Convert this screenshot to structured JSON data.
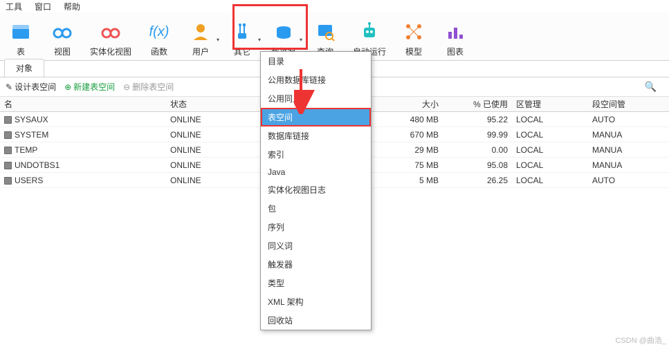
{
  "menubar": {
    "items": [
      "工具",
      "窗口",
      "帮助"
    ]
  },
  "ribbon": [
    {
      "label": "表",
      "icon": "table"
    },
    {
      "label": "视图",
      "icon": "glasses"
    },
    {
      "label": "实体化视图",
      "icon": "glasses-red"
    },
    {
      "label": "函数",
      "icon": "fx"
    },
    {
      "label": "用户",
      "icon": "user",
      "split": true
    },
    {
      "label": "其它",
      "icon": "tools",
      "split": true,
      "highlight": true
    },
    {
      "label": "数据泵",
      "icon": "pump",
      "split": true
    },
    {
      "label": "查询",
      "icon": "query"
    },
    {
      "label": "自动运行",
      "icon": "robot"
    },
    {
      "label": "模型",
      "icon": "model"
    },
    {
      "label": "图表",
      "icon": "chart"
    }
  ],
  "tabs": {
    "active": "对象"
  },
  "toolbar": {
    "design": "设计表空间",
    "new": "新建表空间",
    "delete": "删除表空间"
  },
  "columns": {
    "name": "名",
    "status": "状态",
    "size": "大小",
    "pct": "% 已使用",
    "ext": "区管理",
    "seg": "段空间管"
  },
  "rows": [
    {
      "name": "SYSAUX",
      "status": "ONLINE",
      "size": "480 MB",
      "pct": "95.22",
      "ext": "LOCAL",
      "seg": "AUTO"
    },
    {
      "name": "SYSTEM",
      "status": "ONLINE",
      "size": "670 MB",
      "pct": "99.99",
      "ext": "LOCAL",
      "seg": "MANUA"
    },
    {
      "name": "TEMP",
      "status": "ONLINE",
      "size": "29 MB",
      "pct": "0.00",
      "ext": "LOCAL",
      "seg": "MANUA"
    },
    {
      "name": "UNDOTBS1",
      "status": "ONLINE",
      "size": "75 MB",
      "pct": "95.08",
      "ext": "LOCAL",
      "seg": "MANUA"
    },
    {
      "name": "USERS",
      "status": "ONLINE",
      "size": "5 MB",
      "pct": "26.25",
      "ext": "LOCAL",
      "seg": "AUTO"
    }
  ],
  "dropdown": {
    "items": [
      "目录",
      "公用数据库链接",
      "公用同义词",
      "表空间",
      "数据库链接",
      "索引",
      "Java",
      "实体化视图日志",
      "包",
      "序列",
      "同义词",
      "触发器",
      "类型",
      "XML 架构",
      "回收站"
    ],
    "highlightIndex": 3
  },
  "watermark": "CSDN @曲浩_"
}
